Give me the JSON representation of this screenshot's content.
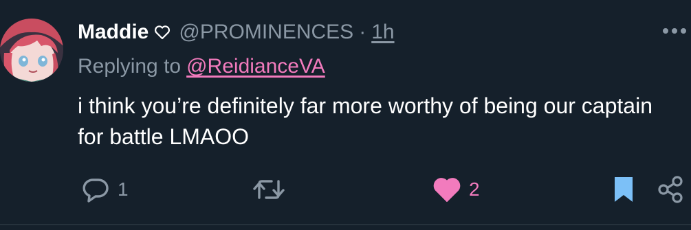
{
  "tweet": {
    "author": {
      "display_name": "Maddie",
      "name_emoji_icon": "heart-outline-icon",
      "handle": "@PROMINENCES"
    },
    "separator": "·",
    "time": "1h",
    "reply": {
      "prefix": "Replying to",
      "mention": "@ReidianceVA"
    },
    "text": "i think you’re definitely far more worthy of being our captain for battle LMAOO",
    "actions": {
      "reply_count": "1",
      "retweet_count": "",
      "like_count": "2",
      "liked": true,
      "bookmarked": true
    }
  },
  "colors": {
    "background": "#15202b",
    "secondary_text": "#8b98a5",
    "accent_pink": "#f27bbd",
    "bookmark_blue": "#7cc0f7"
  },
  "icons": [
    "more-icon",
    "reply-icon",
    "retweet-icon",
    "like-icon",
    "bookmark-icon",
    "share-icon"
  ]
}
